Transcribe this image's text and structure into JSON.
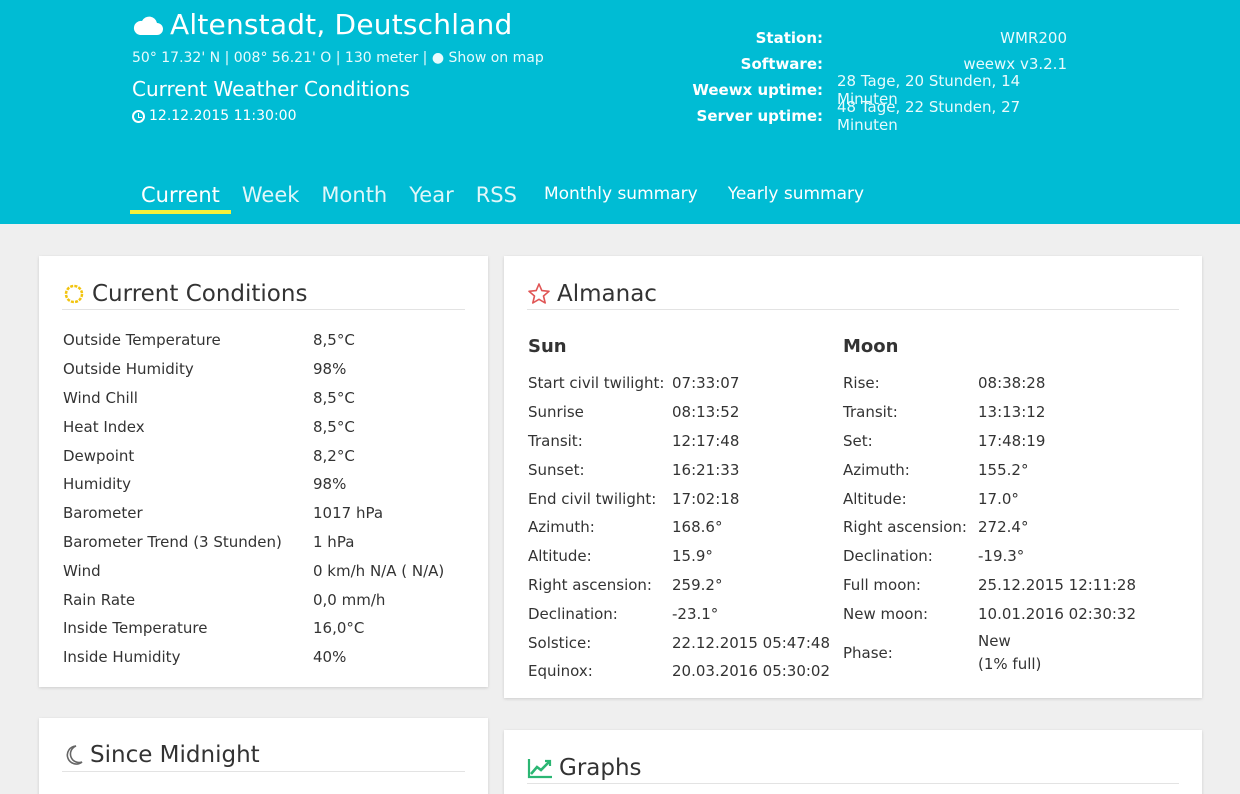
{
  "header": {
    "location": "Altenstadt, Deutschland",
    "coords": "50° 17.32' N | 008° 56.21' O | 130 meter |",
    "map_link": "Show on map",
    "subtitle": "Current Weather Conditions",
    "datetime": "12.12.2015 11:30:00",
    "stats": [
      {
        "key": "Station:",
        "value": "WMR200"
      },
      {
        "key": "Software:",
        "value": "weewx v3.2.1"
      },
      {
        "key": "Weewx uptime:",
        "value": "28 Tage, 20 Stunden, 14 Minuten"
      },
      {
        "key": "Server uptime:",
        "value": "48 Tage, 22 Stunden, 27 Minuten"
      }
    ],
    "accent_color": "#00bcd4",
    "active_underline_color": "#f4f13b"
  },
  "nav": {
    "current": "Current",
    "week": "Week",
    "month": "Month",
    "year": "Year",
    "rss": "RSS",
    "monthly": "Monthly summary",
    "yearly": "Yearly summary"
  },
  "current_conditions": {
    "title": "Current Conditions",
    "rows": [
      {
        "k": "Outside Temperature",
        "v": "8,5°C"
      },
      {
        "k": "Outside Humidity",
        "v": "98%"
      },
      {
        "k": "Wind Chill",
        "v": "8,5°C"
      },
      {
        "k": "Heat Index",
        "v": "8,5°C"
      },
      {
        "k": "Dewpoint",
        "v": "8,2°C"
      },
      {
        "k": "Humidity",
        "v": "98%"
      },
      {
        "k": "Barometer",
        "v": "1017 hPa"
      },
      {
        "k": "Barometer Trend (3 Stunden)",
        "v": "1 hPa"
      },
      {
        "k": "Wind",
        "v": "0 km/h N/A ( N/A)"
      },
      {
        "k": "Rain Rate",
        "v": "0,0 mm/h"
      },
      {
        "k": "Inside Temperature",
        "v": "16,0°C"
      },
      {
        "k": "Inside Humidity",
        "v": "40%"
      }
    ]
  },
  "almanac": {
    "title": "Almanac",
    "sun_heading": "Sun",
    "moon_heading": "Moon",
    "sun": [
      {
        "k": "Start civil twilight:",
        "v": "07:33:07"
      },
      {
        "k": "Sunrise",
        "v": "08:13:52"
      },
      {
        "k": "Transit:",
        "v": "12:17:48"
      },
      {
        "k": "Sunset:",
        "v": "16:21:33"
      },
      {
        "k": "End civil twilight:",
        "v": "17:02:18"
      },
      {
        "k": "Azimuth:",
        "v": "168.6°"
      },
      {
        "k": "Altitude:",
        "v": "15.9°"
      },
      {
        "k": "Right ascension:",
        "v": "259.2°"
      },
      {
        "k": "Declination:",
        "v": "-23.1°"
      },
      {
        "k": "Solstice:",
        "v": "22.12.2015 05:47:48"
      },
      {
        "k": "Equinox:",
        "v": "20.03.2016 05:30:02"
      }
    ],
    "moon": [
      {
        "k": "Rise:",
        "v": "08:38:28"
      },
      {
        "k": "Transit:",
        "v": "13:13:12"
      },
      {
        "k": "Set:",
        "v": "17:48:19"
      },
      {
        "k": "Azimuth:",
        "v": "155.2°"
      },
      {
        "k": "Altitude:",
        "v": "17.0°"
      },
      {
        "k": "Right ascension:",
        "v": "272.4°"
      },
      {
        "k": "Declination:",
        "v": "-19.3°"
      },
      {
        "k": "Full moon:",
        "v": "25.12.2015 12:11:28"
      },
      {
        "k": "New moon:",
        "v": "10.01.2016 02:30:32"
      }
    ],
    "phase_label": "Phase:",
    "phase_value": "New",
    "phase_full": "(1% full)"
  },
  "since_midnight": {
    "title": "Since Midnight"
  },
  "graphs": {
    "title": "Graphs"
  }
}
